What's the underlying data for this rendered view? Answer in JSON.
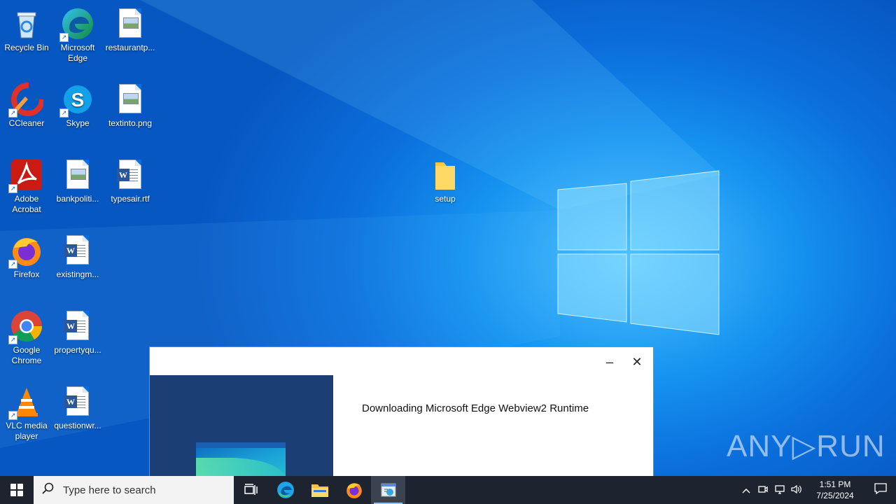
{
  "desktop": {
    "icons": [
      {
        "label": "Recycle Bin"
      },
      {
        "label": "Microsoft Edge"
      },
      {
        "label": "restaurantp..."
      },
      {
        "label": "CCleaner"
      },
      {
        "label": "Skype"
      },
      {
        "label": "textinto.png"
      },
      {
        "label": "Adobe Acrobat"
      },
      {
        "label": "bankpoliti..."
      },
      {
        "label": "typesair.rtf"
      },
      {
        "label": "Firefox"
      },
      {
        "label": "existingm..."
      },
      {
        "label": "Google Chrome"
      },
      {
        "label": "propertyqu..."
      },
      {
        "label": "VLC media player"
      },
      {
        "label": "questionwr..."
      },
      {
        "label": "setup"
      }
    ]
  },
  "installer_window": {
    "message": "Downloading Microsoft Edge Webview2 Runtime",
    "minimize_glyph": "–",
    "close_glyph": "✕"
  },
  "watermark": {
    "text": "ANY▷RUN"
  },
  "taskbar": {
    "search_placeholder": "Type here to search",
    "apps": [
      {
        "name": "task-view-icon"
      },
      {
        "name": "edge-icon"
      },
      {
        "name": "file-explorer-icon"
      },
      {
        "name": "firefox-icon"
      },
      {
        "name": "installer-icon"
      }
    ],
    "clock_time": "1:51 PM",
    "clock_date": "7/25/2024"
  },
  "colors": {
    "taskbar": "#1d2430",
    "installer_panel": "#1b3e74",
    "desktop_accent": "#1592f0"
  }
}
